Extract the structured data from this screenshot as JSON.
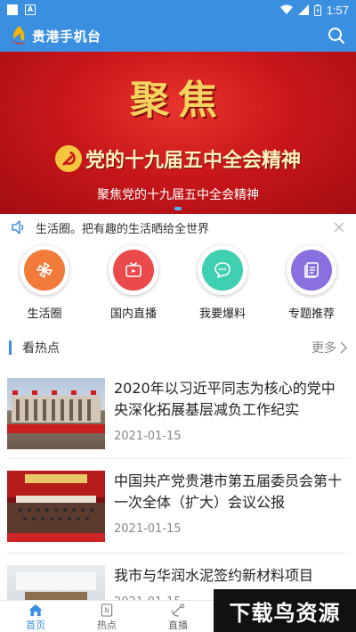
{
  "status_bar": {
    "time": "1:57",
    "icons": [
      "wifi-icon",
      "signal-icon",
      "battery-icon"
    ]
  },
  "header": {
    "title": "贵港手机台",
    "search_icon": "search-icon"
  },
  "banner": {
    "headline": "聚焦",
    "subtitle": "党的十九届五中全会精神",
    "caption": "聚焦党的十九届五中全会精神",
    "slide_count": 1
  },
  "notice": {
    "text": "生活圈。把有趣的生活晒给全世界",
    "icon": "speaker-icon"
  },
  "quick_menu": [
    {
      "label": "生活圈",
      "icon": "pinwheel-icon",
      "color": "#f27a3a"
    },
    {
      "label": "国内直播",
      "icon": "tv-icon",
      "color": "#ea4a4a"
    },
    {
      "label": "我要爆料",
      "icon": "chat-icon",
      "color": "#3fcfb1"
    },
    {
      "label": "专题推荐",
      "icon": "document-icon",
      "color": "#8a6fe0"
    }
  ],
  "section": {
    "title": "看热点",
    "more": "更多"
  },
  "news": [
    {
      "title": "2020年以习近平同志为核心的党中央深化拓展基层减负工作纪实",
      "date": "2021-01-15"
    },
    {
      "title": "中国共产党贵港市第五届委员会第十一次全体（扩大）会议公报",
      "date": "2021-01-15"
    },
    {
      "title": "我市与华润水泥签约新材料项目",
      "date": "2021-01-15"
    }
  ],
  "bottom_nav": [
    {
      "label": "首页",
      "icon": "home-icon",
      "active": true
    },
    {
      "label": "热点",
      "icon": "news-icon",
      "active": false
    },
    {
      "label": "直播",
      "icon": "live-icon",
      "active": false
    }
  ],
  "watermark": "下载鸟资源",
  "colors": {
    "primary": "#3b8fe0",
    "banner_red": "#c9171b",
    "gold": "#f4d35e"
  }
}
